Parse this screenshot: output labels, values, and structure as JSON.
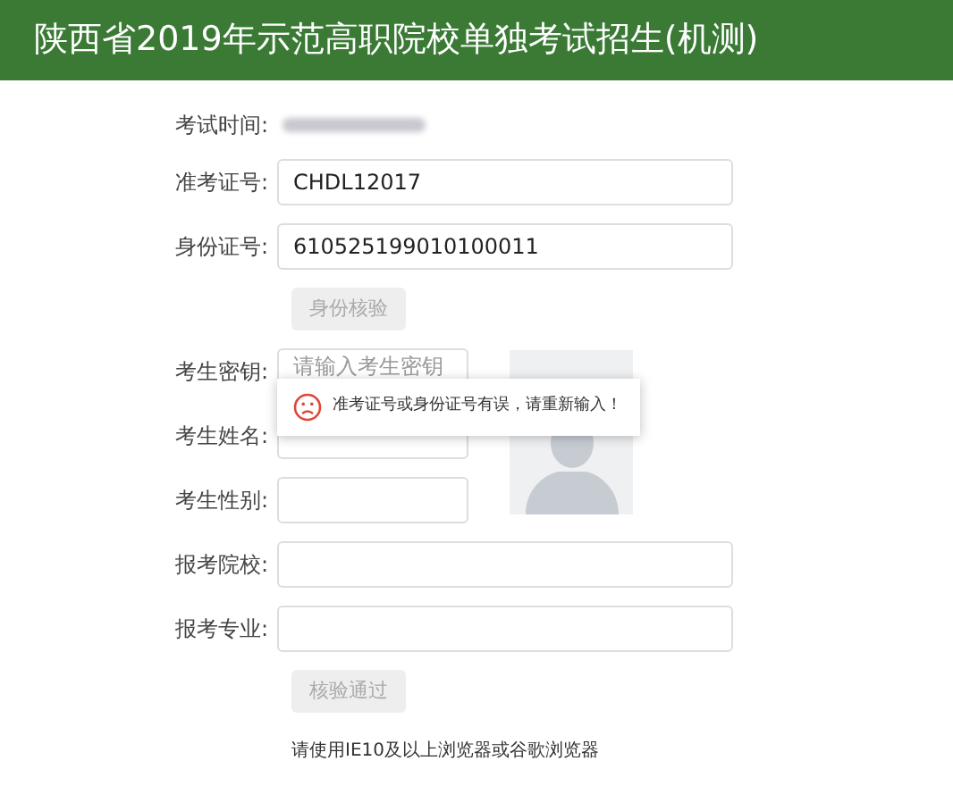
{
  "header": {
    "title": "陕西省2019年示范高职院校单独考试招生(机测)"
  },
  "exam_time": {
    "label": "考试时间:"
  },
  "id_fields": [
    {
      "label": "准考证号:",
      "value": "CHDL12017"
    },
    {
      "label": "身份证号:",
      "value": "610525199010100011"
    }
  ],
  "verify_button": {
    "label": "身份核验",
    "disabled": true
  },
  "personal_fields": [
    {
      "label": "考生密钥:",
      "placeholder": "请输入考生密钥"
    },
    {
      "label": "考生姓名:"
    },
    {
      "label": "考生性别:"
    }
  ],
  "school_fields": [
    {
      "label": "报考院校:"
    },
    {
      "label": "报考专业:"
    }
  ],
  "pass_button": {
    "label": "核验通过",
    "disabled": true
  },
  "note": "请使用IE10及以上浏览器或谷歌浏览器",
  "toast": {
    "message": "准考证号或身份证号有误，请重新输入！"
  }
}
